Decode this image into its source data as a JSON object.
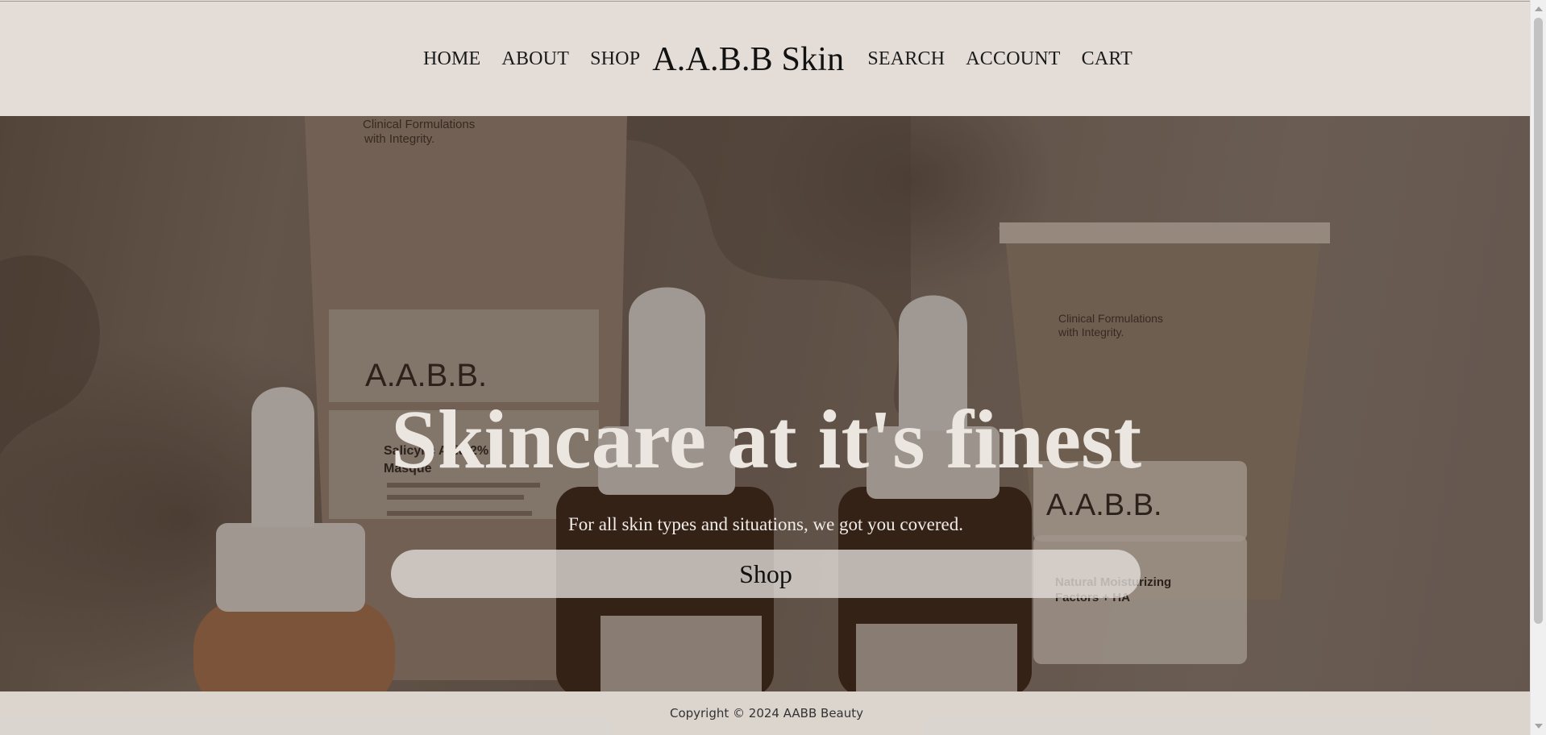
{
  "header": {
    "nav_left": [
      "HOME",
      "ABOUT",
      "SHOP"
    ],
    "brand": "A.A.B.B Skin",
    "nav_right": [
      "SEARCH",
      "ACCOUNT",
      "CART"
    ]
  },
  "hero": {
    "title": "Skincare at it's finest",
    "subtitle": "For all skin types and situations, we got you covered.",
    "button_label": "Shop"
  },
  "photo_labels": {
    "brand_mark": "A.A.B.B.",
    "tagline": "Clinical Formulations",
    "tagline2": "with Integrity.",
    "product_left_1": "Salicylic Acid 2%",
    "product_left_2": "Masque",
    "product_right_1": "Natural Moisturizing",
    "product_right_2": "Factors + HA"
  },
  "footer": {
    "copyright": "Copyright © 2024 AABB Beauty"
  },
  "colors": {
    "header_bg": "#e4ddd7",
    "hero_text": "#ece6e1",
    "button_bg": "#e4dfdb",
    "footer_bg": "#dad4ce"
  }
}
